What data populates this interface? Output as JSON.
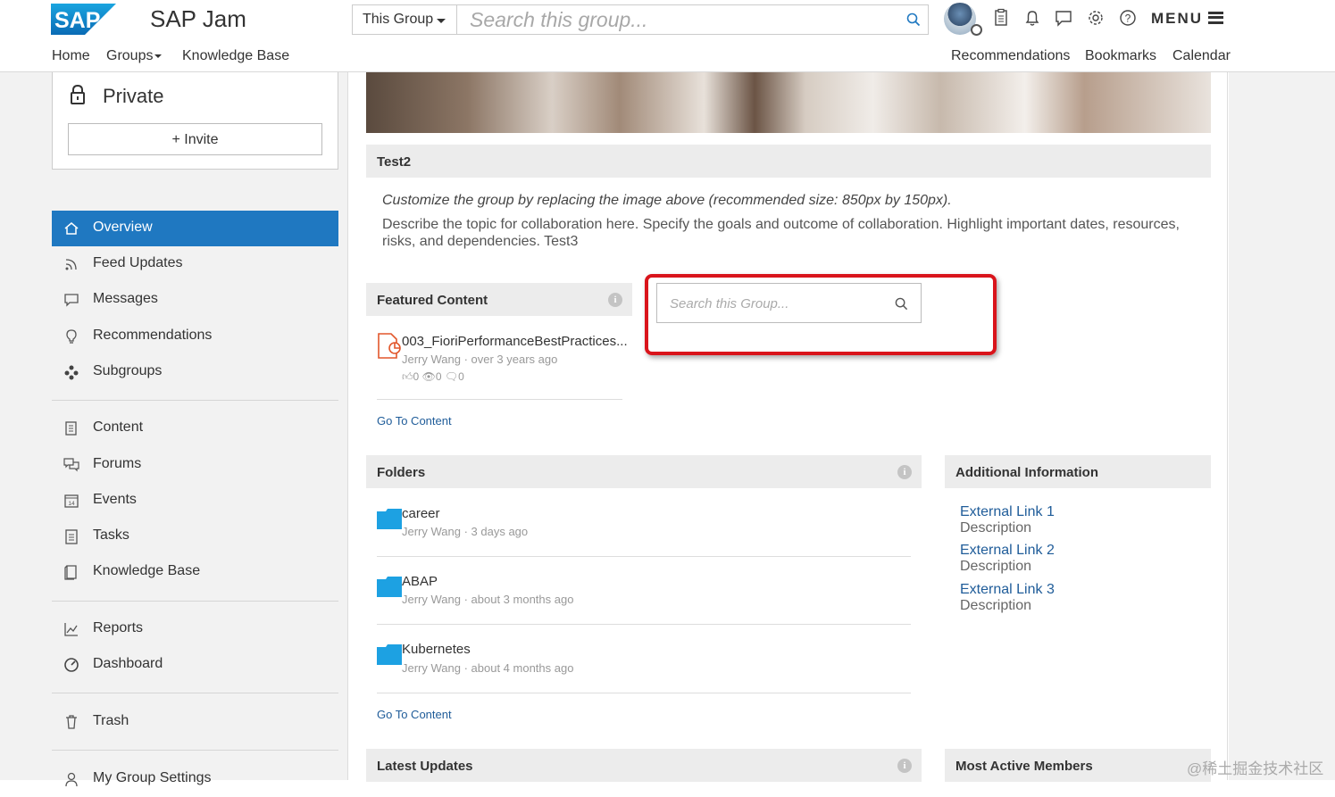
{
  "header": {
    "app_title": "SAP Jam",
    "logo_text": "SAP",
    "scope": "This Group",
    "search_placeholder": "Search this group...",
    "menu_label": "MENU",
    "nav_left": [
      "Home",
      "Groups",
      "Knowledge Base"
    ],
    "nav_right": [
      "Recommendations",
      "Bookmarks",
      "Calendar"
    ],
    "icons": [
      "avatar",
      "tasks-icon",
      "bell-icon",
      "chat-icon",
      "gear-icon",
      "help-icon",
      "hamburger-icon"
    ]
  },
  "sidebar": {
    "privacy_label": "Private",
    "invite_label": "+ Invite",
    "items": [
      {
        "label": "Overview",
        "icon": "home-icon",
        "active": true
      },
      {
        "label": "Feed Updates",
        "icon": "rss-icon"
      },
      {
        "label": "Messages",
        "icon": "message-icon"
      },
      {
        "label": "Recommendations",
        "icon": "lightbulb-icon"
      },
      {
        "label": "Subgroups",
        "icon": "subgroups-icon"
      },
      {
        "label": "Content",
        "icon": "content-icon"
      },
      {
        "label": "Forums",
        "icon": "forums-icon"
      },
      {
        "label": "Events",
        "icon": "calendar-icon"
      },
      {
        "label": "Tasks",
        "icon": "tasks-icon"
      },
      {
        "label": "Knowledge Base",
        "icon": "knowledge-base-icon"
      },
      {
        "label": "Reports",
        "icon": "reports-icon"
      },
      {
        "label": "Dashboard",
        "icon": "dashboard-icon"
      },
      {
        "label": "Trash",
        "icon": "trash-icon"
      },
      {
        "label": "My Group Settings",
        "icon": "user-settings-icon"
      }
    ]
  },
  "main": {
    "group_name": "Test2",
    "description_hint": "Customize the group by replacing the image above (recommended size: 850px by 150px).",
    "description": "Describe the topic for collaboration here. Specify the goals and outcome of collaboration. Highlight important dates, resources, risks, and dependencies. Test3",
    "featured": {
      "title": "Featured Content",
      "item": {
        "name": "003_FioriPerformanceBestPractices...",
        "meta": "Jerry Wang · over 3 years ago",
        "likes": "0",
        "views": "0",
        "comments": "0"
      },
      "goto": "Go To Content"
    },
    "group_search_placeholder": "Search this Group...",
    "folders": {
      "title": "Folders",
      "items": [
        {
          "name": "career",
          "meta": "Jerry Wang · 3 days ago"
        },
        {
          "name": "ABAP",
          "meta": "Jerry Wang · about 3 months ago"
        },
        {
          "name": "Kubernetes",
          "meta": "Jerry Wang · about 4 months ago"
        }
      ],
      "goto": "Go To Content"
    },
    "additional_info": {
      "title": "Additional Information",
      "links": [
        {
          "label": "External Link 1",
          "desc": "Description"
        },
        {
          "label": "External Link 2",
          "desc": "Description"
        },
        {
          "label": "External Link 3",
          "desc": "Description"
        }
      ]
    },
    "latest_updates_title": "Latest Updates",
    "most_active_title": "Most Active Members"
  },
  "colors": {
    "accent": "#1f78c1",
    "link": "#1f5c99",
    "highlight": "#d9141b",
    "folder": "#1da1e2"
  },
  "watermark": "@稀土掘金技术社区"
}
